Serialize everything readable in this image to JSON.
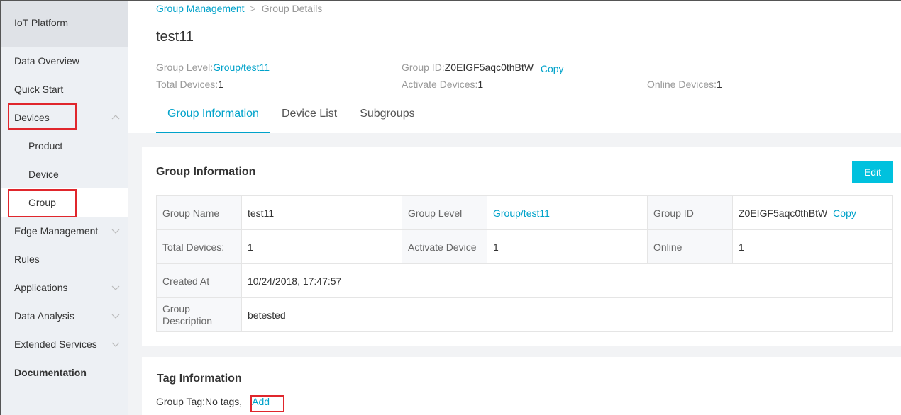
{
  "sidebar": {
    "brand": "IoT Platform",
    "items": [
      {
        "label": "Data Overview"
      },
      {
        "label": "Quick Start"
      },
      {
        "label": "Devices"
      },
      {
        "label": "Product"
      },
      {
        "label": "Device"
      },
      {
        "label": "Group"
      },
      {
        "label": "Edge Management"
      },
      {
        "label": "Rules"
      },
      {
        "label": "Applications"
      },
      {
        "label": "Data Analysis"
      },
      {
        "label": "Extended Services"
      },
      {
        "label": "Documentation"
      }
    ]
  },
  "breadcrumb": {
    "parent": "Group Management",
    "current": "Group Details"
  },
  "page_title": "test11",
  "summary": {
    "group_level_label": "Group Level:",
    "group_level_value": "Group/test11",
    "group_id_label": "Group ID:",
    "group_id_value": "Z0EIGF5aqc0thBtW",
    "copy": "Copy",
    "total_devices_label": "Total Devices:",
    "total_devices_value": "1",
    "activate_devices_label": "Activate Devices:",
    "activate_devices_value": "1",
    "online_devices_label": "Online Devices:",
    "online_devices_value": "1"
  },
  "tabs": [
    {
      "label": "Group Information"
    },
    {
      "label": "Device List"
    },
    {
      "label": "Subgroups"
    }
  ],
  "group_info": {
    "title": "Group Information",
    "edit": "Edit",
    "rows": {
      "group_name_label": "Group Name",
      "group_name_value": "test11",
      "group_level_label": "Group Level",
      "group_level_value": "Group/test11",
      "group_id_label": "Group ID",
      "group_id_value": "Z0EIGF5aqc0thBtW",
      "copy": "Copy",
      "total_devices_label": "Total Devices:",
      "total_devices_value": "1",
      "activate_device_label": "Activate Device",
      "activate_device_value": "1",
      "online_label": "Online",
      "online_value": "1",
      "created_at_label": "Created At",
      "created_at_value": "10/24/2018, 17:47:57",
      "description_label": "Group Description",
      "description_value": "betested"
    }
  },
  "tag_info": {
    "title": "Tag Information",
    "group_tag_label": "Group Tag:",
    "group_tag_value": "No tags,",
    "add": "Add"
  },
  "colors": {
    "accent": "#00a2ca",
    "button": "#00c1de",
    "highlight_box": "#e0262c"
  }
}
